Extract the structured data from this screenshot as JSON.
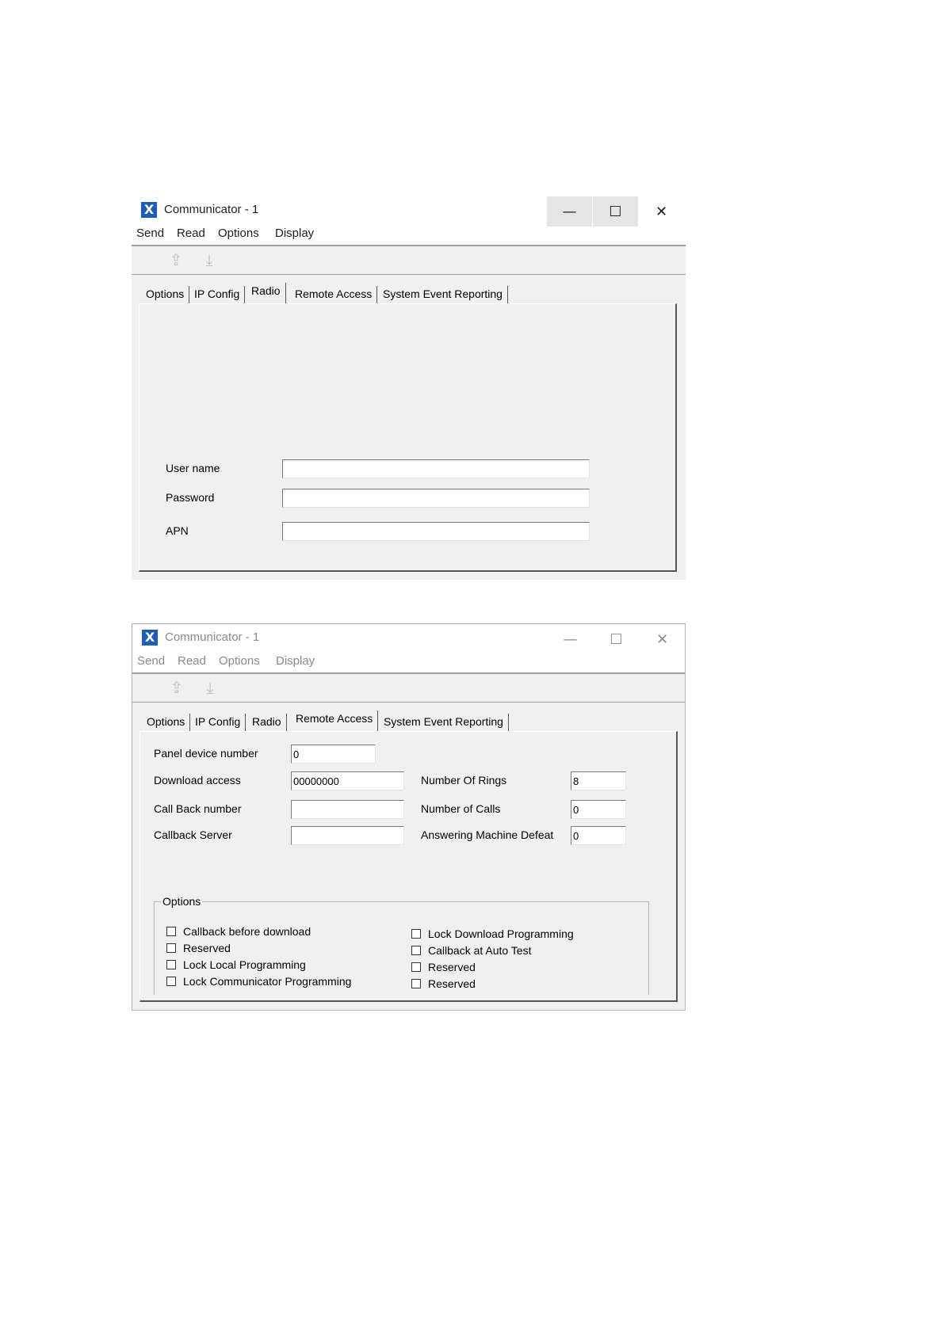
{
  "window1": {
    "title": "Communicator - 1",
    "controls": {
      "minimize": "—",
      "maximize": "☐",
      "close": "✕"
    },
    "menu": [
      "Send",
      "Read",
      "Options",
      "Display"
    ],
    "tabs": [
      "Options",
      "IP Config",
      "Radio",
      "Remote Access",
      "System Event Reporting"
    ],
    "active_tab": "Radio",
    "fields": {
      "user_name": {
        "label": "User name",
        "value": ""
      },
      "password": {
        "label": "Password",
        "value": ""
      },
      "apn": {
        "label": "APN",
        "value": ""
      }
    }
  },
  "window2": {
    "title": "Communicator - 1",
    "controls": {
      "minimize": "—",
      "maximize": "☐",
      "close": "✕"
    },
    "menu": [
      "Send",
      "Read",
      "Options",
      "Display"
    ],
    "tabs": [
      "Options",
      "IP Config",
      "Radio",
      "Remote Access",
      "System Event Reporting"
    ],
    "active_tab": "Remote Access",
    "fields": {
      "panel_device_number": {
        "label": "Panel device number",
        "value": "0"
      },
      "download_access": {
        "label": "Download access",
        "value": "00000000"
      },
      "call_back_number": {
        "label": "Call Back number",
        "value": ""
      },
      "callback_server": {
        "label": "Callback Server",
        "value": ""
      },
      "number_of_rings": {
        "label": "Number Of Rings",
        "value": "8"
      },
      "number_of_calls": {
        "label": "Number of Calls",
        "value": "0"
      },
      "answering_machine_defeat": {
        "label": "Answering Machine Defeat",
        "value": "0"
      }
    },
    "options_group": {
      "legend": "Options",
      "left": [
        "Callback before download",
        "Reserved",
        "Lock Local Programming",
        "Lock Communicator Programming"
      ],
      "right": [
        "Lock Download Programming",
        "Callback at Auto Test",
        "Reserved",
        "Reserved"
      ]
    }
  },
  "icons": {
    "app": "X",
    "send_icon": "⇪",
    "receive_icon": "⤓"
  },
  "colors": {
    "app_icon": "#1f5bb8",
    "dialog_bg": "#f0f0f0",
    "inactive_text": "#8a8a8a"
  }
}
